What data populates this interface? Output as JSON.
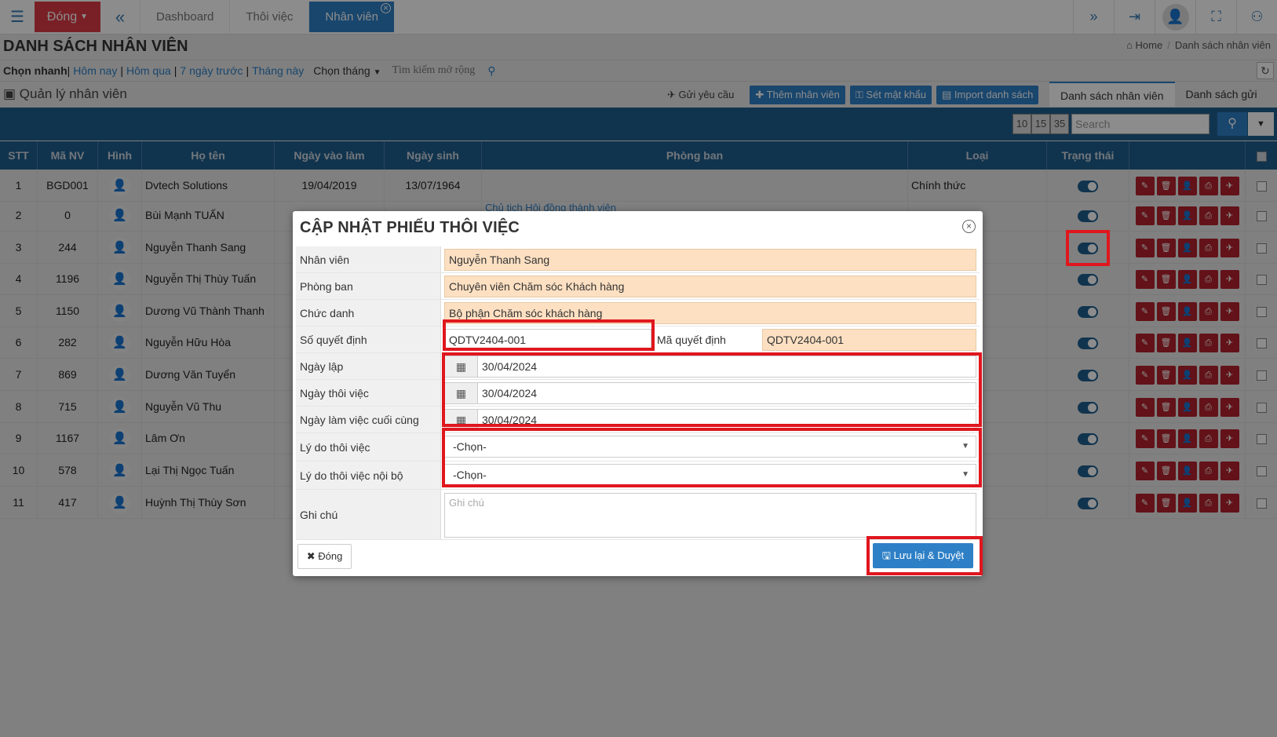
{
  "topbar": {
    "close_label": "Đóng",
    "tabs": [
      "Dashboard",
      "Thôi việc",
      "Nhân viên"
    ]
  },
  "page": {
    "title": "DANH SÁCH NHÂN VIÊN",
    "breadcrumb": [
      "Home",
      "Danh sách nhân viên"
    ]
  },
  "filters": {
    "quick_label": "Chọn nhanh",
    "links": [
      "Hôm nay",
      "Hôm qua",
      "7 ngày trước",
      "Tháng này"
    ],
    "month_label": "Chọn tháng",
    "extended_search": "Tìm kiếm mở rộng"
  },
  "manager": {
    "title": "Quản lý nhân viên",
    "send_request": "Gửi yêu cầu",
    "add_employee": "Thêm nhân viên",
    "set_password": "Sét mật khẩu",
    "import_list": "Import danh sách",
    "tabs": [
      "Danh sách nhân viên",
      "Danh sách gửi"
    ]
  },
  "toolbar": {
    "page_sizes": [
      "10",
      "15",
      "35"
    ],
    "search_placeholder": "Search"
  },
  "table": {
    "headers": [
      "STT",
      "Mã NV",
      "Hình",
      "Họ tên",
      "Ngày vào làm",
      "Ngày sinh",
      "Phòng ban",
      "Loại",
      "Trạng thái"
    ],
    "rows": [
      {
        "stt": "1",
        "code": "BGD001",
        "name": "Dvtech Solutions",
        "start": "19/04/2019",
        "dob": "13/07/1964",
        "dept": "",
        "type": "Chính thức"
      },
      {
        "stt": "2",
        "code": "0",
        "name": "Bùi Mạnh TUẤN",
        "start": "",
        "dob": "",
        "dept": "Chủ tịch Hội đồng thành viên",
        "type": ""
      },
      {
        "stt": "3",
        "code": "244",
        "name": "Nguyễn Thanh Sang",
        "start": "",
        "dob": "",
        "dept": "",
        "type": ""
      },
      {
        "stt": "4",
        "code": "1196",
        "name": "Nguyễn Thị Thùy Tuấn",
        "start": "",
        "dob": "",
        "dept": "",
        "type": ""
      },
      {
        "stt": "5",
        "code": "1150",
        "name": "Dương Vũ Thành Thanh",
        "start": "",
        "dob": "",
        "dept": "",
        "type": ""
      },
      {
        "stt": "6",
        "code": "282",
        "name": "Nguyễn Hữu Hòa",
        "start": "",
        "dob": "",
        "dept": "",
        "type": ""
      },
      {
        "stt": "7",
        "code": "869",
        "name": "Dương Văn Tuyển",
        "start": "",
        "dob": "",
        "dept": "",
        "type": ""
      },
      {
        "stt": "8",
        "code": "715",
        "name": "Nguyễn Vũ Thu",
        "start": "",
        "dob": "",
        "dept": "",
        "type": ""
      },
      {
        "stt": "9",
        "code": "1167",
        "name": "Lâm Ơn",
        "start": "",
        "dob": "",
        "dept": "",
        "type": ""
      },
      {
        "stt": "10",
        "code": "578",
        "name": "Lại Thị Ngọc Tuấn",
        "start": "",
        "dob": "",
        "dept": "",
        "type": ""
      },
      {
        "stt": "11",
        "code": "417",
        "name": "Huỳnh Thị Thùy Sơn",
        "start": "",
        "dob": "",
        "dept": "",
        "type": ""
      }
    ]
  },
  "modal": {
    "title": "CẬP NHẬT PHIẾU THÔI VIỆC",
    "fields": {
      "employee_label": "Nhân viên",
      "employee_value": "Nguyễn Thanh Sang",
      "department_label": "Phòng ban",
      "department_value": "Chuyên viên Chăm sóc Khách hàng",
      "position_label": "Chức danh",
      "position_value": "Bộ phận Chăm sóc khách hàng",
      "decision_no_label": "Số quyết định",
      "decision_no_value": "QDTV2404-001",
      "decision_code_label": "Mã quyết định",
      "decision_code_value": "QDTV2404-001",
      "created_date_label": "Ngày lập",
      "created_date_value": "30/04/2024",
      "resign_date_label": "Ngày thôi việc",
      "resign_date_value": "30/04/2024",
      "last_day_label": "Ngày làm việc cuối cùng",
      "last_day_value": "30/04/2024",
      "reason_label": "Lý do thôi việc",
      "reason_value": "-Chọn-",
      "internal_reason_label": "Lý do thôi việc nội bộ",
      "internal_reason_value": "-Chọn-",
      "note_label": "Ghi chú",
      "note_placeholder": "Ghi chú"
    },
    "close_label": "Đóng",
    "save_label": "Lưu lại & Duyệt"
  },
  "colors": {
    "primary": "#2e80c6",
    "header_blue": "#1f5f8f",
    "danger": "#dd3b46",
    "highlight": "#e0161e",
    "readonly_field": "#fde0c2"
  }
}
